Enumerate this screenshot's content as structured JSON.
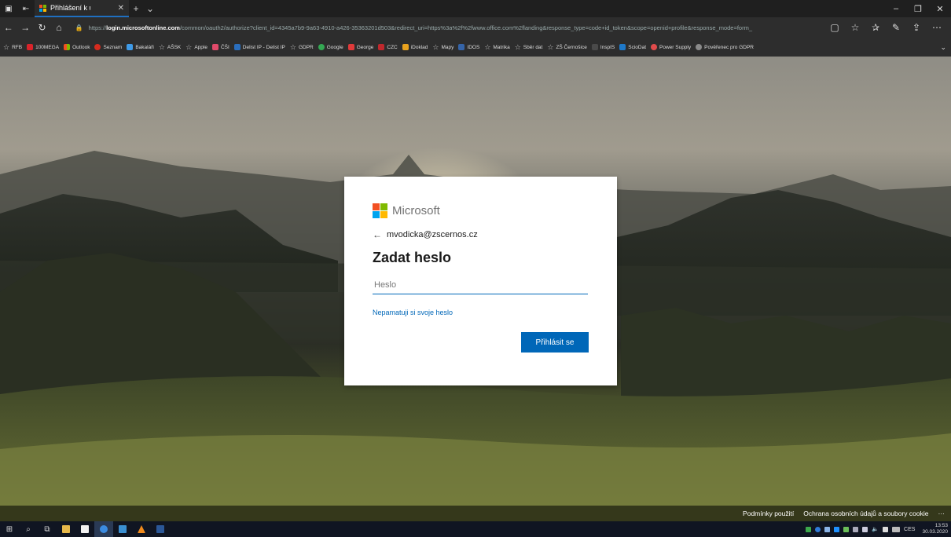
{
  "browser": {
    "tab_title": "Přihlášení k účtu",
    "url_prefix": "https://",
    "url_host": "login.microsoftonline.com",
    "url_rest": "/common/oauth2/authorize?client_id=4345a7b9-9a63-4910-a426-35363201d503&redirect_uri=https%3a%2f%2fwww.office.com%2flanding&response_type=code+id_token&scope=openid+profile&response_mode=form_"
  },
  "favorites": [
    {
      "label": "RFB",
      "icon": "star-icon",
      "color": ""
    },
    {
      "label": "100MEGA",
      "icon": "100mega-icon",
      "color": "#d9232a"
    },
    {
      "label": "Outlook",
      "icon": "ms-grid-icon",
      "color": ""
    },
    {
      "label": "Seznam",
      "icon": "seznam-icon",
      "color": "#d52b1e"
    },
    {
      "label": "Bakaláři",
      "icon": "bakalari-icon",
      "color": "#3f9be8"
    },
    {
      "label": "AŠSK",
      "icon": "star-icon",
      "color": ""
    },
    {
      "label": "Apple",
      "icon": "star-icon",
      "color": ""
    },
    {
      "label": "ČŠI",
      "icon": "shield-icon",
      "color": "#e04a6a"
    },
    {
      "label": "Delist IP - Delist IP",
      "icon": "page-icon",
      "color": "#2a6ebd"
    },
    {
      "label": "GDPR",
      "icon": "star-icon",
      "color": ""
    },
    {
      "label": "Google",
      "icon": "google-icon",
      "color": "#34a853"
    },
    {
      "label": "George",
      "icon": "george-icon",
      "color": "#e03a3a"
    },
    {
      "label": "CZC",
      "icon": "czc-icon",
      "color": "#c0282d"
    },
    {
      "label": "iDoklad",
      "icon": "idoklad-icon",
      "color": "#e8a21e"
    },
    {
      "label": "Mapy",
      "icon": "star-icon",
      "color": ""
    },
    {
      "label": "IDOS",
      "icon": "idos-icon",
      "color": "#3564a8"
    },
    {
      "label": "Matrika",
      "icon": "star-icon",
      "color": ""
    },
    {
      "label": "Sběr dat",
      "icon": "star-icon",
      "color": ""
    },
    {
      "label": "ZŠ Černošice",
      "icon": "star-icon",
      "color": ""
    },
    {
      "label": "InspIS",
      "icon": "inspis-icon",
      "color": "#4a4a4a"
    },
    {
      "label": "ScioDat",
      "icon": "sciodat-icon",
      "color": "#1e78c8"
    },
    {
      "label": "Power Supply",
      "icon": "power-supply-icon",
      "color": "#e14b4b"
    },
    {
      "label": "Pověřenec pro GDPR",
      "icon": "gdpr-icon",
      "color": "#8a8a8a"
    }
  ],
  "login": {
    "brand": "Microsoft",
    "identity": "mvodicka@zscernos.cz",
    "heading": "Zadat heslo",
    "password_placeholder": "Heslo",
    "forgot_link": "Nepamatuji si svoje heslo",
    "signin_button": "Přihlásit se"
  },
  "footer": {
    "terms": "Podmínky použití",
    "privacy": "Ochrana osobních údajů a soubory cookie",
    "more": "···"
  },
  "taskbar": {
    "language": "CES",
    "time": "13:53",
    "date": "30.03.2020"
  },
  "colors": {
    "accent": "#0067b8",
    "ms_red": "#f25022",
    "ms_green": "#7fba00",
    "ms_blue": "#00a4ef",
    "ms_yellow": "#ffb900"
  }
}
